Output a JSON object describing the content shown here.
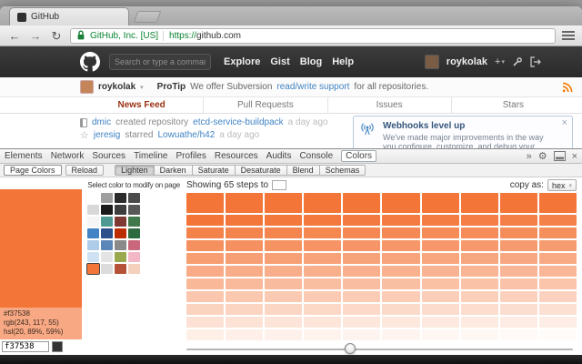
{
  "browser": {
    "tab_title": "GitHub",
    "back_icon": "←",
    "forward_icon": "→",
    "reload_icon": "↻",
    "ev_label": "GitHub, Inc. [US]",
    "url_scheme": "https://",
    "url_host": "github.com"
  },
  "github": {
    "search_placeholder": "Search or type a command",
    "nav": [
      "Explore",
      "Gist",
      "Blog",
      "Help"
    ],
    "username": "roykolak",
    "user_caret": "▾",
    "create_plus": "+",
    "create_caret": "▾",
    "protip": {
      "label": "ProTip",
      "text_before": "We offer Subversion",
      "link_text": "read/write support",
      "text_after": "for all repositories."
    },
    "feed_tabs": [
      {
        "label": "News Feed",
        "active": true
      },
      {
        "label": "Pull Requests",
        "active": false
      },
      {
        "label": "Issues",
        "active": false
      },
      {
        "label": "Stars",
        "active": false
      }
    ],
    "feed": [
      {
        "icon": "repo",
        "actor": "dmic",
        "action": "created repository",
        "target": "etcd-service-buildpack",
        "time": "a day ago"
      },
      {
        "icon": "star",
        "actor": "jeresig",
        "action": "starred",
        "target": "Lowuathe/h42",
        "time": "a day ago"
      }
    ],
    "webhooks": {
      "title": "Webhooks level up",
      "body": "We've made major improvements in the way you configure, customize, and debug your webhooks.",
      "close_icon": "×"
    }
  },
  "devtools": {
    "tabs": [
      "Elements",
      "Network",
      "Sources",
      "Timeline",
      "Profiles",
      "Resources",
      "Audits",
      "Console",
      "Colors"
    ],
    "active_tab": "Colors",
    "overflow_icon": "»",
    "gear_icon": "⚙",
    "close_icon": "×",
    "toolbar": {
      "page_colors": "Page Colors",
      "reload": "Reload",
      "modes": [
        "Lighten",
        "Darken",
        "Saturate",
        "Desaturate",
        "Blend",
        "Schemas"
      ],
      "active_mode": "Lighten"
    },
    "sidebar": {
      "hint": "Select color to modify on page",
      "palette": [
        "#ffffff",
        "#9e9e9e",
        "#2b2b2b",
        "#4a4a4a",
        "#d8d8d8",
        "#1a1a1a",
        "#3d3d3d",
        "#585858",
        "#f5f5f5",
        "#4e9a93",
        "#7e3a32",
        "#41784b",
        "#4183c4",
        "#2c4f8c",
        "#bd2c00",
        "#2d6a3f",
        "#aecbe8",
        "#5a87b8",
        "#8a8a8a",
        "#c9687d",
        "#cfe2f3",
        "#e4e4e4",
        "#9aa84e",
        "#f2b8c6",
        "#f37538",
        "#dcdcdc",
        "#b55238",
        "#f5d0bd"
      ],
      "selected_hex_display": "#f37538",
      "selected_rgb_display": "rgb(243, 117, 55)",
      "selected_hsl_display": "hsl(20, 89%, 59%)",
      "hex_input_value": "f37538",
      "compare_swatch": "#333333"
    },
    "main": {
      "showing_label": "Showing 65 steps to",
      "copy_as_label": "copy as:",
      "copy_format": "hex",
      "copy_caret": "▾",
      "steps": {
        "base": "#f37538",
        "target": "#ffffff",
        "rows": 10,
        "cols": 10
      },
      "slider_percent": 42
    }
  },
  "colors": {
    "accent_orange": "#f37538",
    "link_blue": "#4183c4",
    "active_tab_red": "#9a3214"
  }
}
